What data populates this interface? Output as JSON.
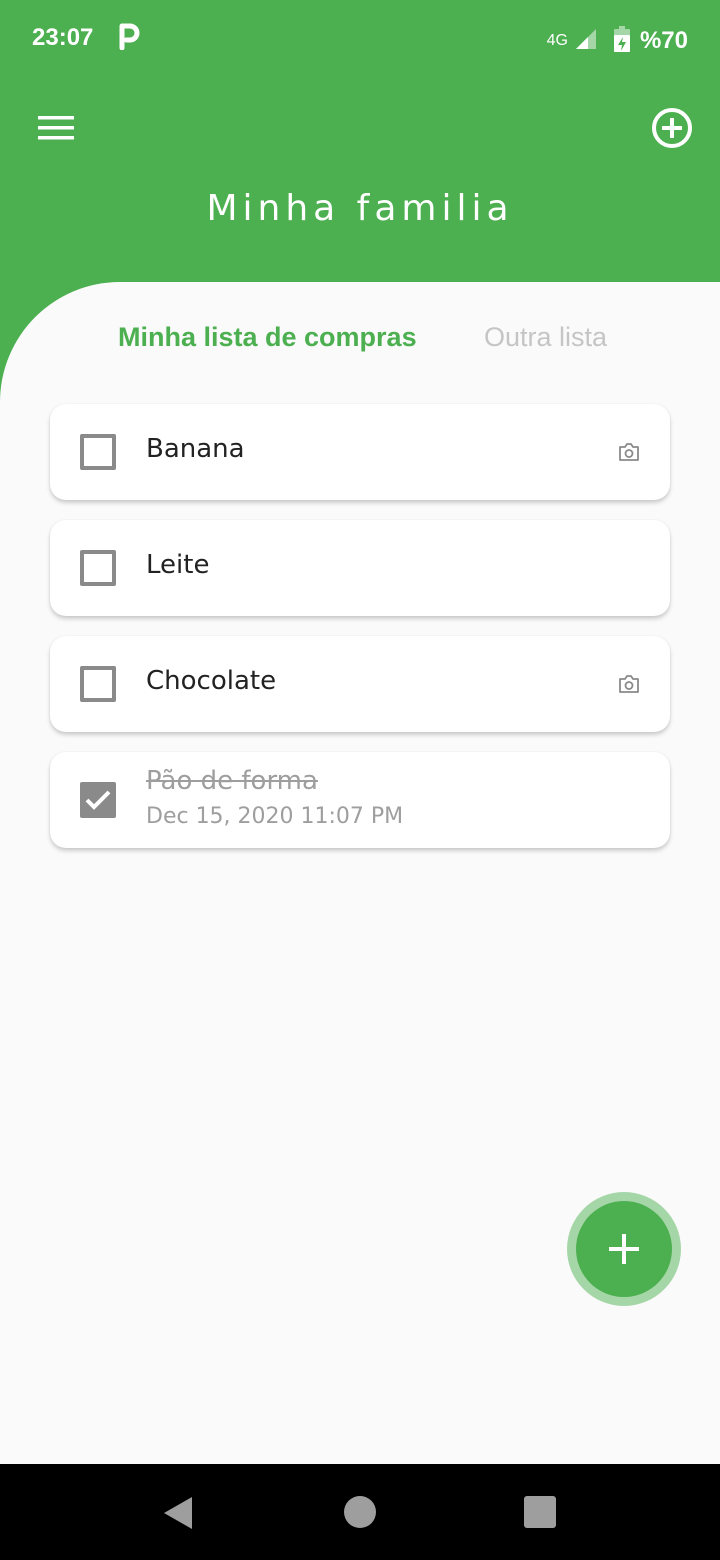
{
  "status_bar": {
    "time": "23:07",
    "network": "4G",
    "battery": "%70",
    "icons": [
      "p-app-icon",
      "signal-icon",
      "battery-charging-icon"
    ]
  },
  "header": {
    "title": "Minha familia",
    "menu_icon": "hamburger-menu-icon",
    "add_icon": "add-circle-icon",
    "background_color": "#4caf50"
  },
  "tabs": [
    {
      "label": "Minha lista de compras",
      "active": true
    },
    {
      "label": "Outra lista",
      "active": false
    }
  ],
  "items": [
    {
      "name": "Banana",
      "checked": false,
      "has_photo": true
    },
    {
      "name": "Leite",
      "checked": false,
      "has_photo": false
    },
    {
      "name": "Chocolate",
      "checked": false,
      "has_photo": true
    },
    {
      "name": "Pão de forma",
      "checked": true,
      "date": "Dec 15, 2020 11:07 PM"
    }
  ],
  "fab": {
    "icon": "plus-icon",
    "color": "#4caf50"
  },
  "nav_bar": {
    "icons": [
      "back-triangle-icon",
      "home-circle-icon",
      "recents-square-icon"
    ]
  }
}
